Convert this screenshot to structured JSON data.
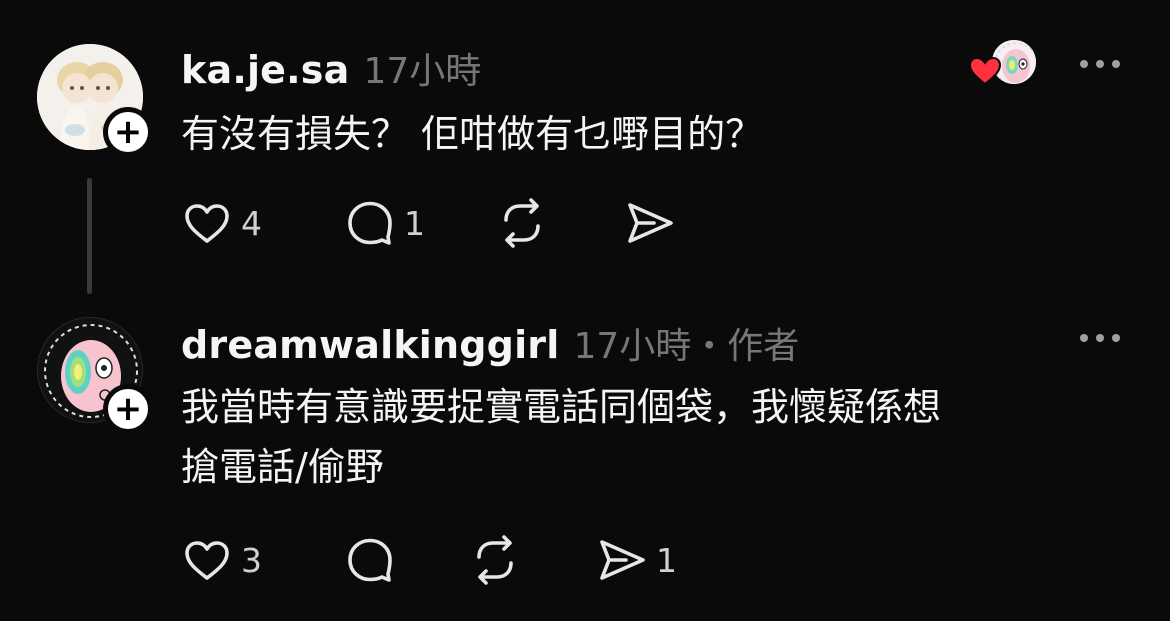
{
  "posts": [
    {
      "username": "ka.je.sa",
      "meta": "17小時",
      "text": "有沒有損失？ 佢咁做有乜嘢目的？",
      "actions": {
        "likes": "4",
        "replies": "1",
        "reposts": "",
        "shares": ""
      },
      "liked_by_author": true,
      "colors": {
        "heart": "#ff3040"
      }
    },
    {
      "username": "dreamwalkinggirl",
      "meta": "17小時・作者",
      "text_lines": [
        "我當時有意識要捉實電話同個袋，我懷疑係想",
        "搶電話/偷野"
      ],
      "actions": {
        "likes": "3",
        "replies": "",
        "reposts": "",
        "shares": "1"
      }
    }
  ],
  "icons": {
    "follow": "plus-icon",
    "like": "heart-outline-icon",
    "reply": "speech-bubble-icon",
    "repost": "repost-icon",
    "share": "send-icon",
    "more": "more-horizontal-icon"
  }
}
